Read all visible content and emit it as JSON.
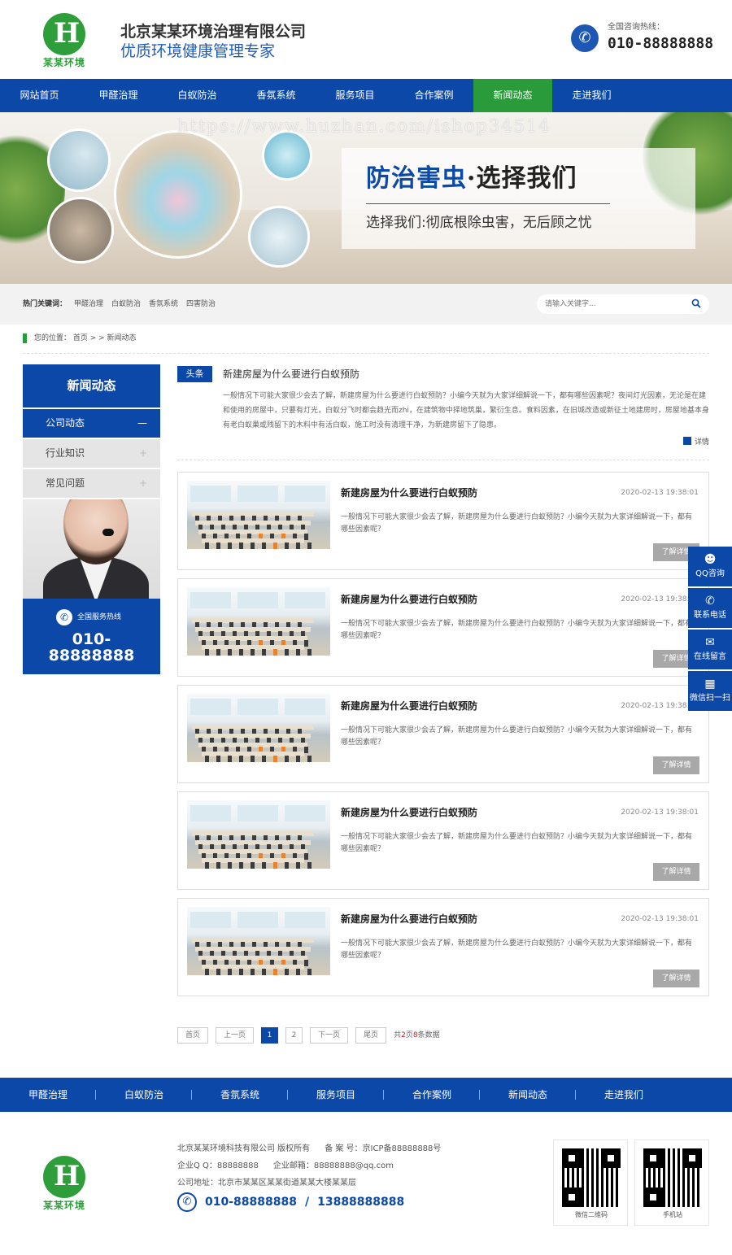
{
  "header": {
    "logo_text": "某某环境",
    "company_name": "北京某某环境治理有限公司",
    "slogan": "优质环境健康管理专家",
    "hotline_label": "全国咨询热线：",
    "hotline_number": "010-88888888"
  },
  "nav": {
    "items": [
      "网站首页",
      "甲醛治理",
      "白蚁防治",
      "香氛系统",
      "服务项目",
      "合作案例",
      "新闻动态",
      "走进我们"
    ],
    "active_index": 6
  },
  "banner": {
    "watermark": "https://www.huzhan.com/ishop34514",
    "title_blue": "防治害虫",
    "title_sep": "·",
    "title_dark": "选择我们",
    "subtitle": "选择我们:彻底根除虫害，无后顾之忧"
  },
  "keywords": {
    "label": "热门关键词：",
    "items": [
      "甲醛治理",
      "白蚁防治",
      "香氛系统",
      "四害防治"
    ],
    "search_placeholder": "请输入关键字..."
  },
  "breadcrumb": {
    "text": "您的位置：  首页 > > 新闻动态"
  },
  "sidebar": {
    "title": "新闻动态",
    "items": [
      {
        "label": "公司动态",
        "symbol": "—"
      },
      {
        "label": "行业知识",
        "symbol": "+"
      },
      {
        "label": "常见问题",
        "symbol": "+"
      }
    ],
    "hotline_label": "全国服务热线",
    "hotline_number_1": "010-",
    "hotline_number_2": "88888888"
  },
  "headline": {
    "tag": "头条",
    "title": "新建房屋为什么要进行白蚁预防",
    "body": "一般情况下可能大家很少会去了解，新建房屋为什么要进行白蚁预防？小编今天就为大家详细解说一下，都有哪些因素呢？夜间灯光因素，无论是在建和使用的房屋中，只要有灯光，白蚁分飞时都会趋光而zhi，在建筑物中择地筑巢，繁衍生息。食料因素，在旧城改造或新征土地建房时，房屋地基本身有老白蚁巢或残留下的木料中有活白蚁，施工时没有清理干净，为新建房留下了隐患。",
    "detail": "详情"
  },
  "news": [
    {
      "title": "新建房屋为什么要进行白蚁预防",
      "date": "2020-02-13 19:38:01",
      "desc": "一般情况下可能大家很少会去了解，新建房屋为什么要进行白蚁预防？小编今天就为大家详细解说一下，都有哪些因素呢？",
      "more": "了解详情"
    },
    {
      "title": "新建房屋为什么要进行白蚁预防",
      "date": "2020-02-13 19:38:01",
      "desc": "一般情况下可能大家很少会去了解，新建房屋为什么要进行白蚁预防？小编今天就为大家详细解说一下，都有哪些因素呢？",
      "more": "了解详情"
    },
    {
      "title": "新建房屋为什么要进行白蚁预防",
      "date": "2020-02-13 19:38:01",
      "desc": "一般情况下可能大家很少会去了解，新建房屋为什么要进行白蚁预防？小编今天就为大家详细解说一下，都有哪些因素呢？",
      "more": "了解详情"
    },
    {
      "title": "新建房屋为什么要进行白蚁预防",
      "date": "2020-02-13 19:38:01",
      "desc": "一般情况下可能大家很少会去了解，新建房屋为什么要进行白蚁预防？小编今天就为大家详细解说一下，都有哪些因素呢？",
      "more": "了解详情"
    },
    {
      "title": "新建房屋为什么要进行白蚁预防",
      "date": "2020-02-13 19:38:01",
      "desc": "一般情况下可能大家很少会去了解，新建房屋为什么要进行白蚁预防？小编今天就为大家详细解说一下，都有哪些因素呢？",
      "more": "了解详情"
    }
  ],
  "pager": {
    "first": "首页",
    "prev": "上一页",
    "pages": [
      "1",
      "2"
    ],
    "current": "1",
    "next": "下一页",
    "last": "尾页",
    "info_prefix": "共",
    "total_pages": "2",
    "info_mid": "页",
    "total_items": "8",
    "info_suffix": "条数据"
  },
  "floatbar": [
    {
      "label": "QQ咨询",
      "icon": "qq-icon"
    },
    {
      "label": "联系电话",
      "icon": "phone-icon"
    },
    {
      "label": "在线留言",
      "icon": "message-icon"
    },
    {
      "label": "微信扫一扫",
      "icon": "qrcode-icon"
    }
  ],
  "footer_nav": [
    "甲醛治理",
    "白蚁防治",
    "香氛系统",
    "服务项目",
    "合作案例",
    "新闻动态",
    "走进我们"
  ],
  "footer": {
    "logo_text": "某某环境",
    "copyright": "北京某某环境科技有限公司 版权所有",
    "icp": "备 案 号：京ICP备88888888号",
    "qq": "企业Q Q：88888888",
    "email": "企业邮箱：88888888@qq.com",
    "address": "公司地址：北京市某某区某某街道某某大楼某某层",
    "phone1": "010-88888888",
    "phone_sep": "/",
    "phone2": "13888888888",
    "qr1_label": "微信二维码",
    "qr2_label": "手机站"
  },
  "colors": {
    "brand_blue": "#0c48a8",
    "brand_green": "#2a9b3b"
  }
}
